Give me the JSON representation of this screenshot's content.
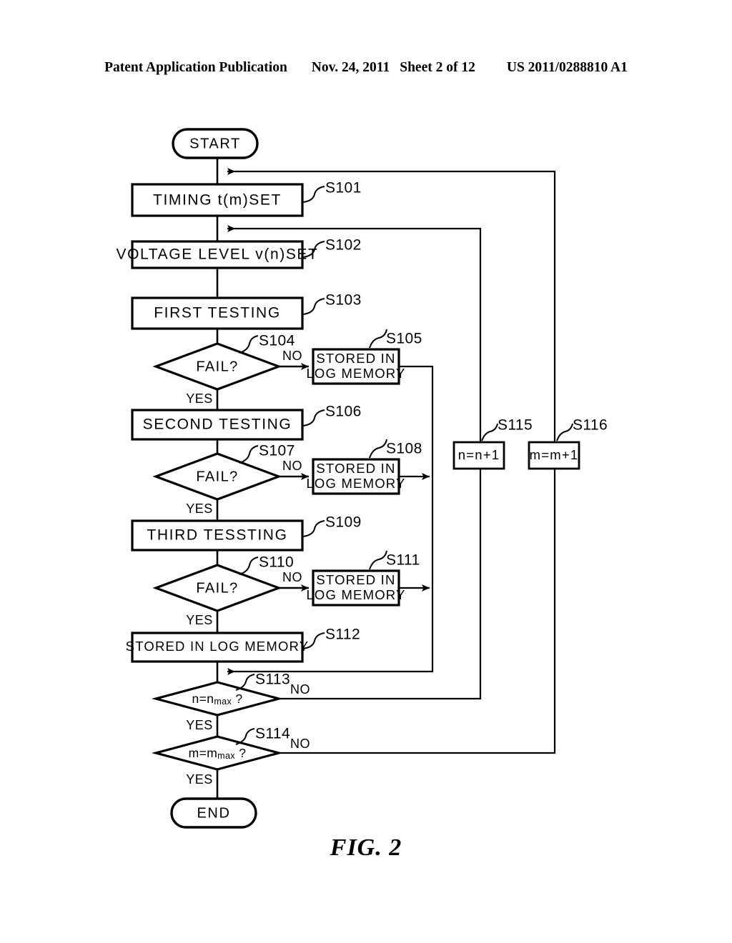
{
  "header": {
    "publication": "Patent Application Publication",
    "date": "Nov. 24, 2011",
    "sheet": "Sheet 2 of 12",
    "patent_number": "US 2011/0288810 A1"
  },
  "figure": {
    "caption": "FIG. 2"
  },
  "chart_data": {
    "type": "diagram",
    "title": "FIG. 2",
    "subtype": "flowchart",
    "nodes": [
      {
        "id": "START",
        "shape": "terminator",
        "label": "START"
      },
      {
        "id": "S101",
        "shape": "process",
        "label": "TIMING t(m)SET",
        "step": "S101"
      },
      {
        "id": "S102",
        "shape": "process",
        "label": "VOLTAGE LEVEL v(n)SET",
        "step": "S102"
      },
      {
        "id": "S103",
        "shape": "process",
        "label": "FIRST TESTING",
        "step": "S103"
      },
      {
        "id": "S104",
        "shape": "decision",
        "label": "FAIL?",
        "step": "S104"
      },
      {
        "id": "S105",
        "shape": "process",
        "label": "STORED IN LOG MEMORY",
        "label_line1": "STORED IN",
        "label_line2": "LOG MEMORY",
        "step": "S105"
      },
      {
        "id": "S106",
        "shape": "process",
        "label": "SECOND TESTING",
        "step": "S106"
      },
      {
        "id": "S107",
        "shape": "decision",
        "label": "FAIL?",
        "step": "S107"
      },
      {
        "id": "S108",
        "shape": "process",
        "label": "STORED IN LOG MEMORY",
        "label_line1": "STORED IN",
        "label_line2": "LOG MEMORY",
        "step": "S108"
      },
      {
        "id": "S109",
        "shape": "process",
        "label": "THIRD TESSTING",
        "step": "S109"
      },
      {
        "id": "S110",
        "shape": "decision",
        "label": "FAIL?",
        "step": "S110"
      },
      {
        "id": "S111",
        "shape": "process",
        "label": "STORED IN LOG MEMORY",
        "label_line1": "STORED IN",
        "label_line2": "LOG MEMORY",
        "step": "S111"
      },
      {
        "id": "S112",
        "shape": "process",
        "label": "STORED IN LOG MEMORY",
        "step": "S112"
      },
      {
        "id": "S113",
        "shape": "decision",
        "label": "n=nmax ?",
        "label_base": "n=n",
        "label_subscript": "max",
        "label_tail": " ?",
        "step": "S113"
      },
      {
        "id": "S114",
        "shape": "decision",
        "label": "m=mmax ?",
        "label_base": "m=m",
        "label_subscript": "max",
        "label_tail": " ?",
        "step": "S114"
      },
      {
        "id": "S115",
        "shape": "process",
        "label": "n=n+1",
        "step": "S115"
      },
      {
        "id": "S116",
        "shape": "process",
        "label": "m=m+1",
        "step": "S116"
      },
      {
        "id": "END",
        "shape": "terminator",
        "label": "END"
      }
    ],
    "edges": [
      {
        "from": "START",
        "to": "S101",
        "label": ""
      },
      {
        "from": "S101",
        "to": "S102",
        "label": ""
      },
      {
        "from": "S102",
        "to": "S103",
        "label": ""
      },
      {
        "from": "S103",
        "to": "S104",
        "label": ""
      },
      {
        "from": "S104",
        "to": "S105",
        "label": "NO"
      },
      {
        "from": "S104",
        "to": "S106",
        "label": "YES"
      },
      {
        "from": "S106",
        "to": "S107",
        "label": ""
      },
      {
        "from": "S107",
        "to": "S108",
        "label": "NO"
      },
      {
        "from": "S107",
        "to": "S109",
        "label": "YES"
      },
      {
        "from": "S109",
        "to": "S110",
        "label": ""
      },
      {
        "from": "S110",
        "to": "S111",
        "label": "NO"
      },
      {
        "from": "S110",
        "to": "S112",
        "label": "YES"
      },
      {
        "from": "S112",
        "to": "S113",
        "label": ""
      },
      {
        "from": "S105",
        "to": "S113",
        "label": ""
      },
      {
        "from": "S108",
        "to": "S113",
        "label": ""
      },
      {
        "from": "S111",
        "to": "S113",
        "label": ""
      },
      {
        "from": "S113",
        "to": "S115",
        "label": "NO"
      },
      {
        "from": "S113",
        "to": "S114",
        "label": "YES"
      },
      {
        "from": "S114",
        "to": "S116",
        "label": "NO"
      },
      {
        "from": "S114",
        "to": "END",
        "label": "YES"
      },
      {
        "from": "S115",
        "to": "S102",
        "label": ""
      },
      {
        "from": "S116",
        "to": "S101",
        "label": ""
      }
    ],
    "edge_labels": {
      "no": "NO",
      "yes": "YES"
    }
  },
  "labels": {
    "start": "START",
    "end": "END",
    "s101": "TIMING t(m)SET",
    "s102": "VOLTAGE LEVEL v(n)SET",
    "s103": "FIRST TESTING",
    "s104": "FAIL?",
    "s105_l1": "STORED IN",
    "s105_l2": "LOG MEMORY",
    "s106": "SECOND TESTING",
    "s107": "FAIL?",
    "s108_l1": "STORED IN",
    "s108_l2": "LOG MEMORY",
    "s109": "THIRD TESSTING",
    "s110": "FAIL?",
    "s111_l1": "STORED IN",
    "s111_l2": "LOG MEMORY",
    "s112": "STORED IN LOG MEMORY",
    "s113_base": "n=n",
    "s113_sub": "max",
    "s113_tail": "?",
    "s114_base": "m=m",
    "s114_sub": "max",
    "s114_tail": "?",
    "s115": "n=n+1",
    "s116": "m=m+1"
  },
  "steps": {
    "s101": "S101",
    "s102": "S102",
    "s103": "S103",
    "s104": "S104",
    "s105": "S105",
    "s106": "S106",
    "s107": "S107",
    "s108": "S108",
    "s109": "S109",
    "s110": "S110",
    "s111": "S111",
    "s112": "S112",
    "s113": "S113",
    "s114": "S114",
    "s115": "S115",
    "s116": "S116"
  },
  "branch": {
    "no_104": "NO",
    "yes_104": "YES",
    "no_107": "NO",
    "yes_107": "YES",
    "no_110": "NO",
    "yes_110": "YES",
    "no_113": "NO",
    "yes_113": "YES",
    "no_114": "NO",
    "yes_114": "YES"
  }
}
